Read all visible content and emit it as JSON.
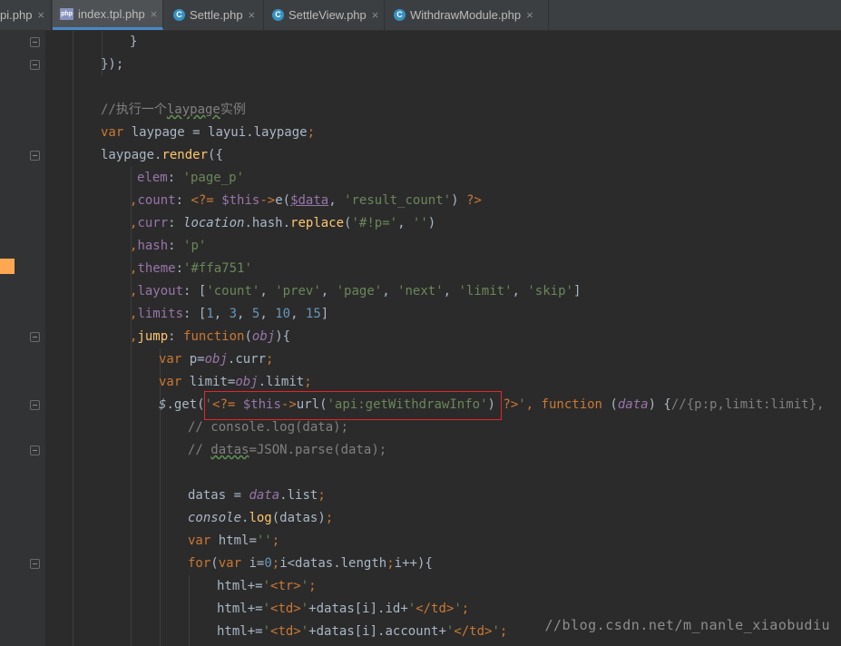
{
  "tabs": [
    {
      "label": "pi.php",
      "icon": "php-file-icon"
    },
    {
      "label": "index.tpl.php",
      "icon": "php-template-icon",
      "active": true
    },
    {
      "label": "Settle.php",
      "icon": "php-class-icon"
    },
    {
      "label": "SettleView.php",
      "icon": "php-class-icon"
    },
    {
      "label": "WithdrawModule.php",
      "icon": "php-class-icon"
    }
  ],
  "close_glyph": "×",
  "bookmark_color": "#ffa751",
  "highlight_color": "#e8232a",
  "code": {
    "line1": "}",
    "line2": "});",
    "line4": "//执行一个laypage实例",
    "line5": "var laypage = layui.laypage;",
    "line6": "laypage.render({",
    "line7": "elem: 'page_p'",
    "line8": ",count: <?= $this->e($data, 'result_count') ?>",
    "line9": ",curr: location.hash.replace('#!p=', '')",
    "line10": ",hash: 'p'",
    "line11": ",theme:'#ffa751'",
    "line12": ",layout: ['count', 'prev', 'page', 'next', 'limit', 'skip']",
    "line13": ",limits: [1, 3, 5, 10, 15]",
    "line14": ",jump: function(obj){",
    "line15": "var p=obj.curr;",
    "line16": "var limit=obj.limit;",
    "line17": "$.get('<?= $this->url('api:getWithdrawInfo') ?>', function (data) {//{p:p,limit:limit},",
    "line18": "// console.log(data);",
    "line19": "// datas=JSON.parse(data);",
    "line21": "datas = data.list;",
    "line22": "console.log(datas);",
    "line23": "var html='';",
    "line24": "for(var i=0;i<datas.length;i++){",
    "line25": "html+='<tr>';",
    "line26": "html+='<td>'+datas[i].id+'</td>';",
    "line27": "html+='<td>'+datas[i].account+'</td>';"
  },
  "watermark": "//blog.csdn.net/m_nanle_xiaobudiu"
}
